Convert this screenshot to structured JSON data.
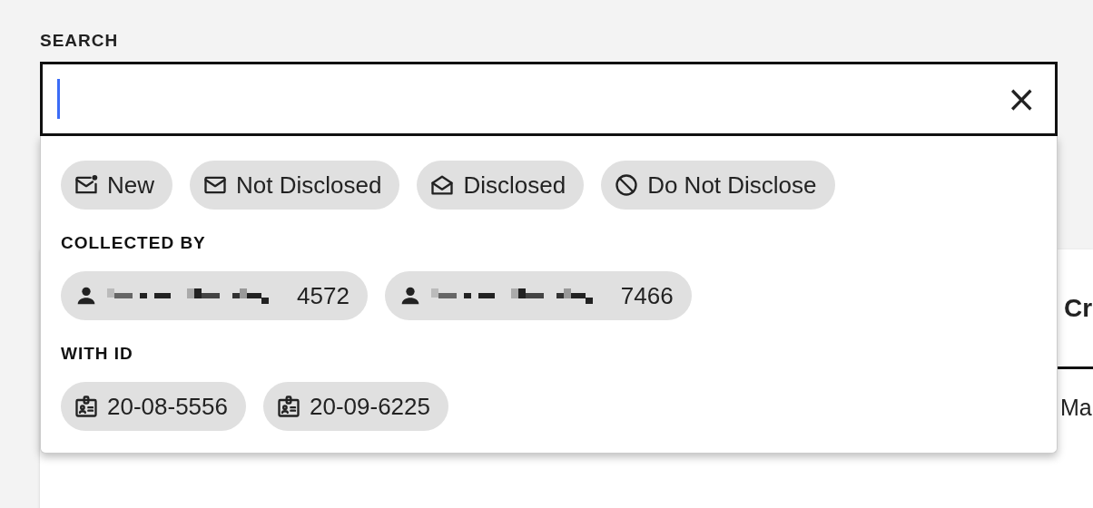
{
  "search": {
    "label": "SEARCH",
    "focused": true,
    "clear": "×"
  },
  "status_chips": [
    {
      "kind": "new",
      "label": "New"
    },
    {
      "kind": "not-disclosed",
      "label": "Not Disclosed"
    },
    {
      "kind": "disclosed",
      "label": "Disclosed"
    },
    {
      "kind": "do-not-disclose",
      "label": "Do Not Disclose"
    }
  ],
  "sections": [
    {
      "title": "COLLECTED BY",
      "chips": [
        {
          "kind": "person",
          "redacted": true,
          "label": "4572"
        },
        {
          "kind": "person",
          "redacted": true,
          "label": "7466"
        }
      ]
    },
    {
      "title": "WITH ID",
      "chips": [
        {
          "kind": "id",
          "label": "20-08-5556"
        },
        {
          "kind": "id",
          "label": "20-09-6225"
        }
      ]
    }
  ],
  "background_card": {
    "tab": "Cr",
    "row": "Ma"
  }
}
